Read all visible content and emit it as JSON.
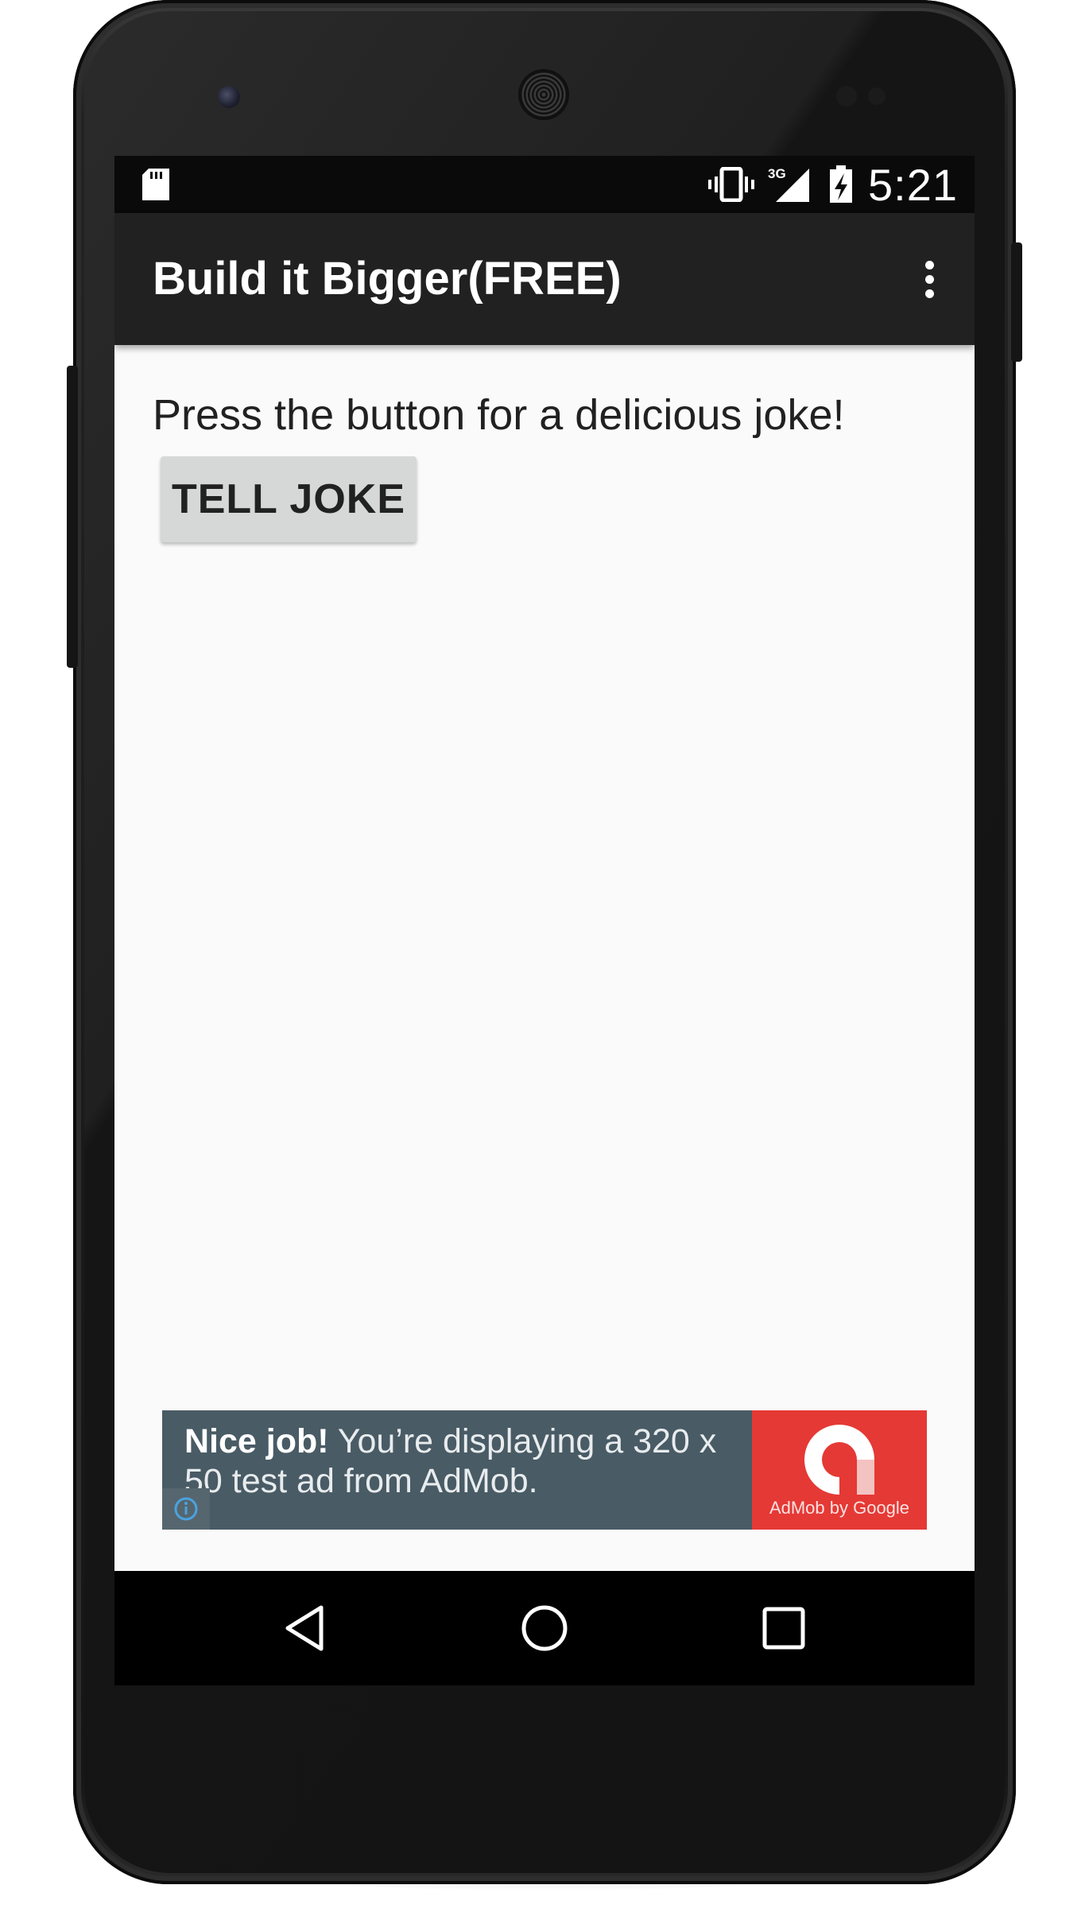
{
  "status_bar": {
    "time": "5:21",
    "network": "3G",
    "icons": [
      "sd-card-icon",
      "vibrate-icon",
      "signal-icon",
      "battery-charging-icon"
    ]
  },
  "app_bar": {
    "title": "Build it Bigger(FREE)",
    "overflow_icon": "more-vert-icon"
  },
  "main": {
    "instructions": "Press the button for a delicious joke!",
    "tell_joke_label": "TELL JOKE"
  },
  "ad": {
    "headline": "Nice job!",
    "body": " You’re displaying a 320 x 50 test ad from AdMob.",
    "brand": "AdMob by Google",
    "info_icon": "info-icon",
    "colors": {
      "background": "#495b65",
      "logo_background": "#e53935"
    }
  },
  "nav_bar": {
    "icons": [
      "back-icon",
      "home-icon",
      "recents-icon"
    ]
  },
  "colors": {
    "app_bar": "#212121",
    "status_bar": "#0a0a0a",
    "content_background": "#fafafa",
    "button": "#d6d7d7"
  }
}
